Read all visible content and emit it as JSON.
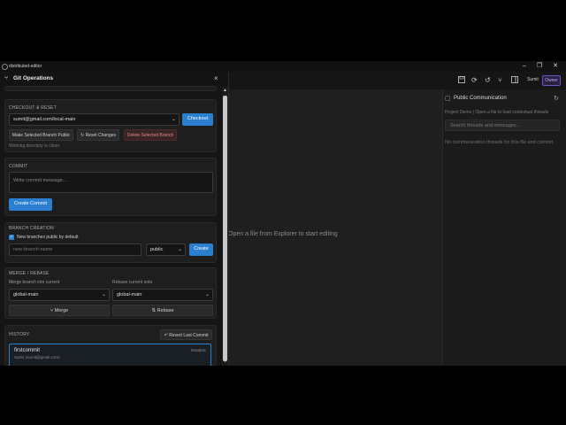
{
  "window": {
    "title": "distributed-editor",
    "controls": {
      "minimize": "–",
      "maximize": "❐",
      "close": "✕"
    }
  },
  "git": {
    "title": "Git Operations",
    "close": "×",
    "checkout": {
      "section_title": "CHECKOUT & RESET",
      "branch_value": "sumit@gmail.com/local-main",
      "checkout_button": "Checkout",
      "make_public_button": "Make Selected Branch Public",
      "reset_button": "Reset Changes",
      "delete_button": "Delete Selected Branch",
      "status": "Working directory is clean."
    },
    "commit": {
      "section_title": "COMMIT",
      "placeholder": "Write commit message...",
      "create_button": "Create Commit"
    },
    "branch_creation": {
      "section_title": "BRANCH CREATION",
      "checkbox_label": "New branches public by default",
      "checkbox_checked": true,
      "name_placeholder": "new-branch-name",
      "visibility_value": "public",
      "create_button": "Create"
    },
    "merge": {
      "section_title": "MERGE / REBASE",
      "merge_label": "Merge branch into current",
      "rebase_label": "Rebase current onto",
      "merge_value": "global-main",
      "rebase_value": "global-main",
      "merge_button": "Merge",
      "rebase_button": "Rebase"
    },
    "history": {
      "section_title": "HISTORY",
      "revert_button": "Revert Last Commit",
      "commits": [
        {
          "message": "firstcommit",
          "author": "Sumit (sumit@gmail.com)",
          "hash": "5eaab4c"
        }
      ]
    }
  },
  "editor": {
    "empty_message": "Open a file from Explorer to start editing",
    "user": "Sumit",
    "role": "Owner"
  },
  "communication": {
    "title": "Public Communication",
    "subtitle": "Project Demo | Open a file to load contextual threads",
    "search_placeholder": "Search threads and messages...",
    "empty": "No communication threads for this file and commit."
  },
  "colors": {
    "accent": "#2a7fd0",
    "owner_badge": "#6a55c8",
    "danger": "#e08a8a"
  }
}
